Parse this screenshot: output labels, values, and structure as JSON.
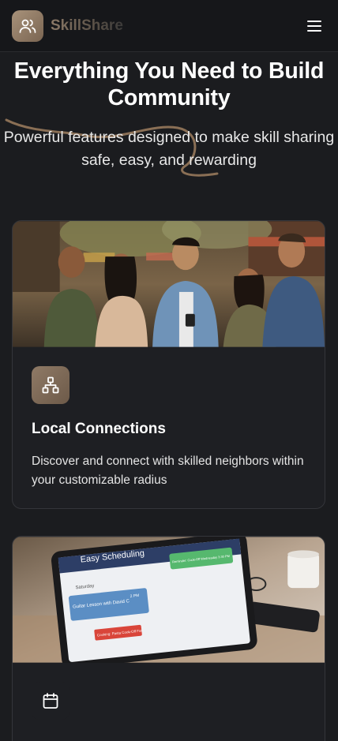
{
  "header": {
    "brand": "SkillShare",
    "logo_icon": "users-icon",
    "menu_icon": "hamburger-menu-icon"
  },
  "hero": {
    "title": "Everything You Need to Build Community",
    "subtitle": "Powerful features designed to make skill sharing safe, easy, and rewarding"
  },
  "features": [
    {
      "icon": "network-icon",
      "title": "Local Connections",
      "description": "Discover and connect with skilled neighbors within your customizable radius"
    },
    {
      "icon": "calendar-icon",
      "image_text": {
        "app_title": "Easy Scheduling",
        "section": "Saturday",
        "event_1": "Guitar Lesson with David C",
        "event_1_time": "2 PM",
        "event_2": "Cooking: Pasta Cook-Off Fun",
        "reminder": "Reminder: Cook-Off Wednesday 3:30 PM"
      }
    }
  ],
  "colors": {
    "background": "#1b1c1f",
    "card": "#1e1f23",
    "accent": "#8f7a66",
    "squiggle": "#8a6f55"
  }
}
